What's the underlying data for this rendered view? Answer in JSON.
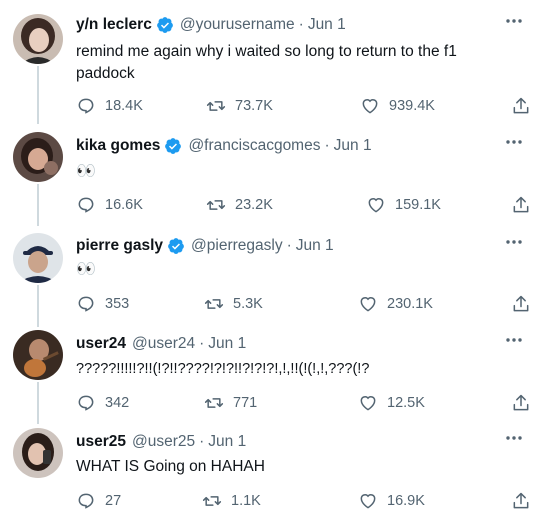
{
  "tweets": [
    {
      "name": "y/n leclerc",
      "verified": true,
      "handle": "@yourusername",
      "date": "Jun 1",
      "text": "remind me again why i waited so long to return to the f1 paddock",
      "replies": "18.4K",
      "retweets": "73.7K",
      "likes": "939.4K",
      "avatar": "woman-dark-hair-avatar"
    },
    {
      "name": "kika gomes",
      "verified": true,
      "handle": "@franciscacgomes",
      "date": "Jun 1",
      "text": "👀",
      "replies": "16.6K",
      "retweets": "23.2K",
      "likes": "159.1K",
      "avatar": "woman-selfie-avatar"
    },
    {
      "name": "pierre gasly",
      "verified": true,
      "handle": "@pierregasly",
      "date": "Jun 1",
      "text": "👀",
      "replies": "353",
      "retweets": "5.3K",
      "likes": "230.1K",
      "avatar": "man-cap-avatar"
    },
    {
      "name": "user24",
      "verified": false,
      "handle": "@user24",
      "date": "Jun 1",
      "text": "?????!!!!!?!!(!?!!????!?!?!!?!?!?!,!,!!(!(!,!,???(!?",
      "replies": "342",
      "retweets": "771",
      "likes": "12.5K",
      "avatar": "guitar-photo-avatar"
    },
    {
      "name": "user25",
      "verified": false,
      "handle": "@user25",
      "date": "Jun 1",
      "text": "WHAT IS Going on HAHAH",
      "replies": "27",
      "retweets": "1.1K",
      "likes": "16.9K",
      "avatar": "woman-phone-avatar"
    }
  ],
  "dot": "·",
  "colors": {
    "verified": "#1d9bf0",
    "secondary_text": "#536471",
    "thread_line": "#cfd9de"
  },
  "icons": [
    "reply-icon",
    "retweet-icon",
    "like-icon",
    "share-icon",
    "more-icon",
    "verified-badge-icon"
  ]
}
